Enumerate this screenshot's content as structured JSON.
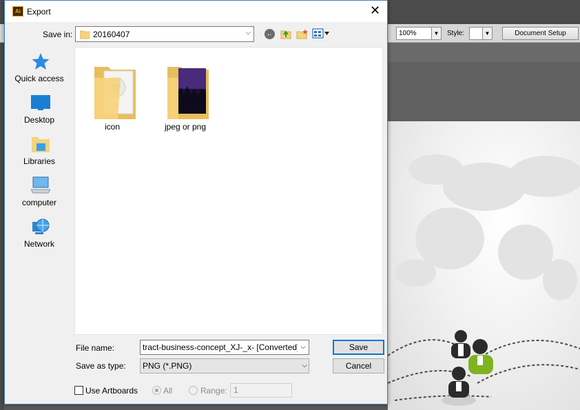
{
  "app": {
    "zoom_value": "100%",
    "style_label": "Style:",
    "document_setup_label": "Document Setup"
  },
  "dialog": {
    "title": "Export",
    "app_logo_text": "Ai",
    "close_glyph": "✕",
    "save_in_label": "Save in:",
    "save_in_value": "20160407",
    "places": [
      {
        "label": "Quick access",
        "icon": "star-icon"
      },
      {
        "label": "Desktop",
        "icon": "desktop-icon"
      },
      {
        "label": "Libraries",
        "icon": "libraries-icon"
      },
      {
        "label": "computer",
        "icon": "computer-icon"
      },
      {
        "label": "Network",
        "icon": "network-icon"
      }
    ],
    "files": [
      {
        "name": "icon",
        "icon": "folder-icon"
      },
      {
        "name": "jpeg or png",
        "icon": "folder-icon"
      }
    ],
    "file_name_label": "File name:",
    "file_name_value": "tract-business-concept_XJ-_x- [Converted].png",
    "save_as_type_label": "Save as type:",
    "save_as_type_value": "PNG (*.PNG)",
    "save_label": "Save",
    "cancel_label": "Cancel",
    "use_artboards_label": "Use Artboards",
    "use_artboards_checked": false,
    "all_label": "All",
    "range_label": "Range:",
    "range_value": "1",
    "colors": {
      "accent": "#0078d7",
      "border": "#3f7fbf",
      "folder": "#f6d37c"
    }
  }
}
